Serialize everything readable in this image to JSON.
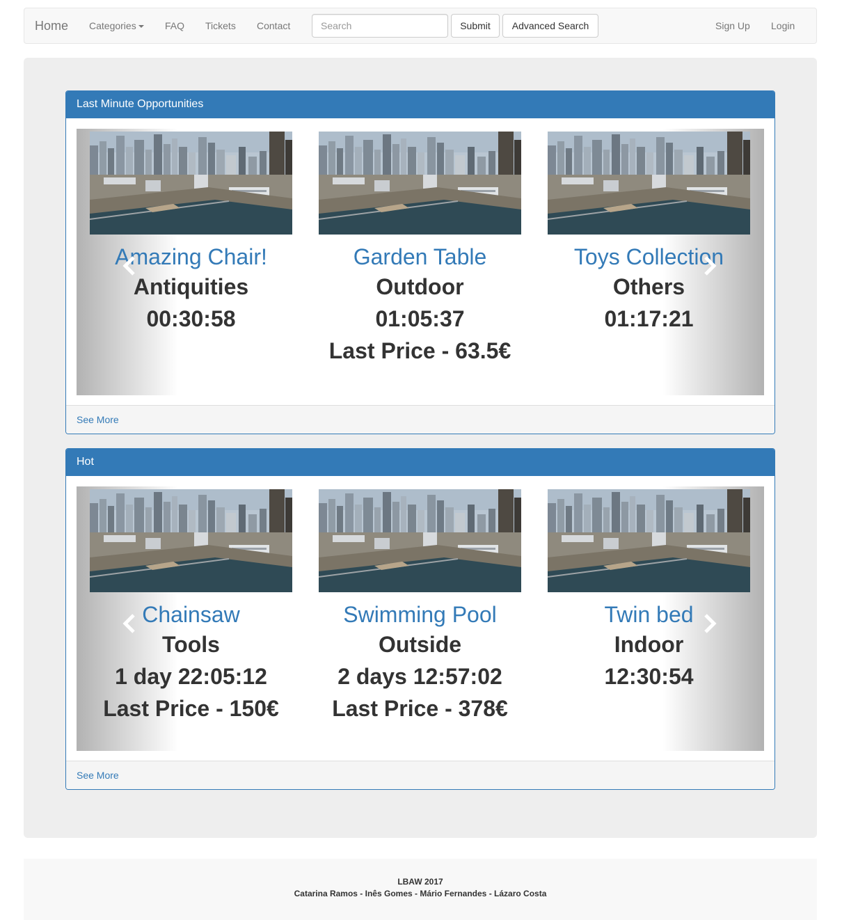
{
  "navbar": {
    "brand": "Home",
    "categories": "Categories",
    "faq": "FAQ",
    "tickets": "Tickets",
    "contact": "Contact",
    "search_placeholder": "Search",
    "submit": "Submit",
    "advanced_search": "Advanced Search",
    "sign_up": "Sign Up",
    "login": "Login"
  },
  "panels": [
    {
      "heading": "Last Minute Opportunities",
      "footer_link": "See More",
      "items": [
        {
          "title": "Amazing Chair!",
          "category": "Antiquities",
          "time": "00:30:58",
          "price": ""
        },
        {
          "title": "Garden Table",
          "category": "Outdoor",
          "time": "01:05:37",
          "price": "Last Price - 63.5€"
        },
        {
          "title": "Toys Collection",
          "category": "Others",
          "time": "01:17:21",
          "price": ""
        }
      ]
    },
    {
      "heading": "Hot",
      "footer_link": "See More",
      "items": [
        {
          "title": "Chainsaw",
          "category": "Tools",
          "time": "1 day 22:05:12",
          "price": "Last Price - 150€"
        },
        {
          "title": "Swimming Pool",
          "category": "Outside",
          "time": "2 days 12:57:02",
          "price": "Last Price - 378€"
        },
        {
          "title": "Twin bed",
          "category": "Indoor",
          "time": "12:30:54",
          "price": ""
        }
      ]
    }
  ],
  "footer": {
    "line1": "LBAW 2017",
    "line2": "Catarina Ramos - Inês Gomes - Mário Fernandes - Lázaro Costa"
  },
  "icons": {
    "prev": "chevron-left-icon",
    "next": "chevron-right-icon",
    "caret": "caret-down-icon"
  },
  "colors": {
    "primary": "#337ab7",
    "navbar_bg": "#f8f8f8",
    "jumbotron_bg": "#eeeeee"
  }
}
